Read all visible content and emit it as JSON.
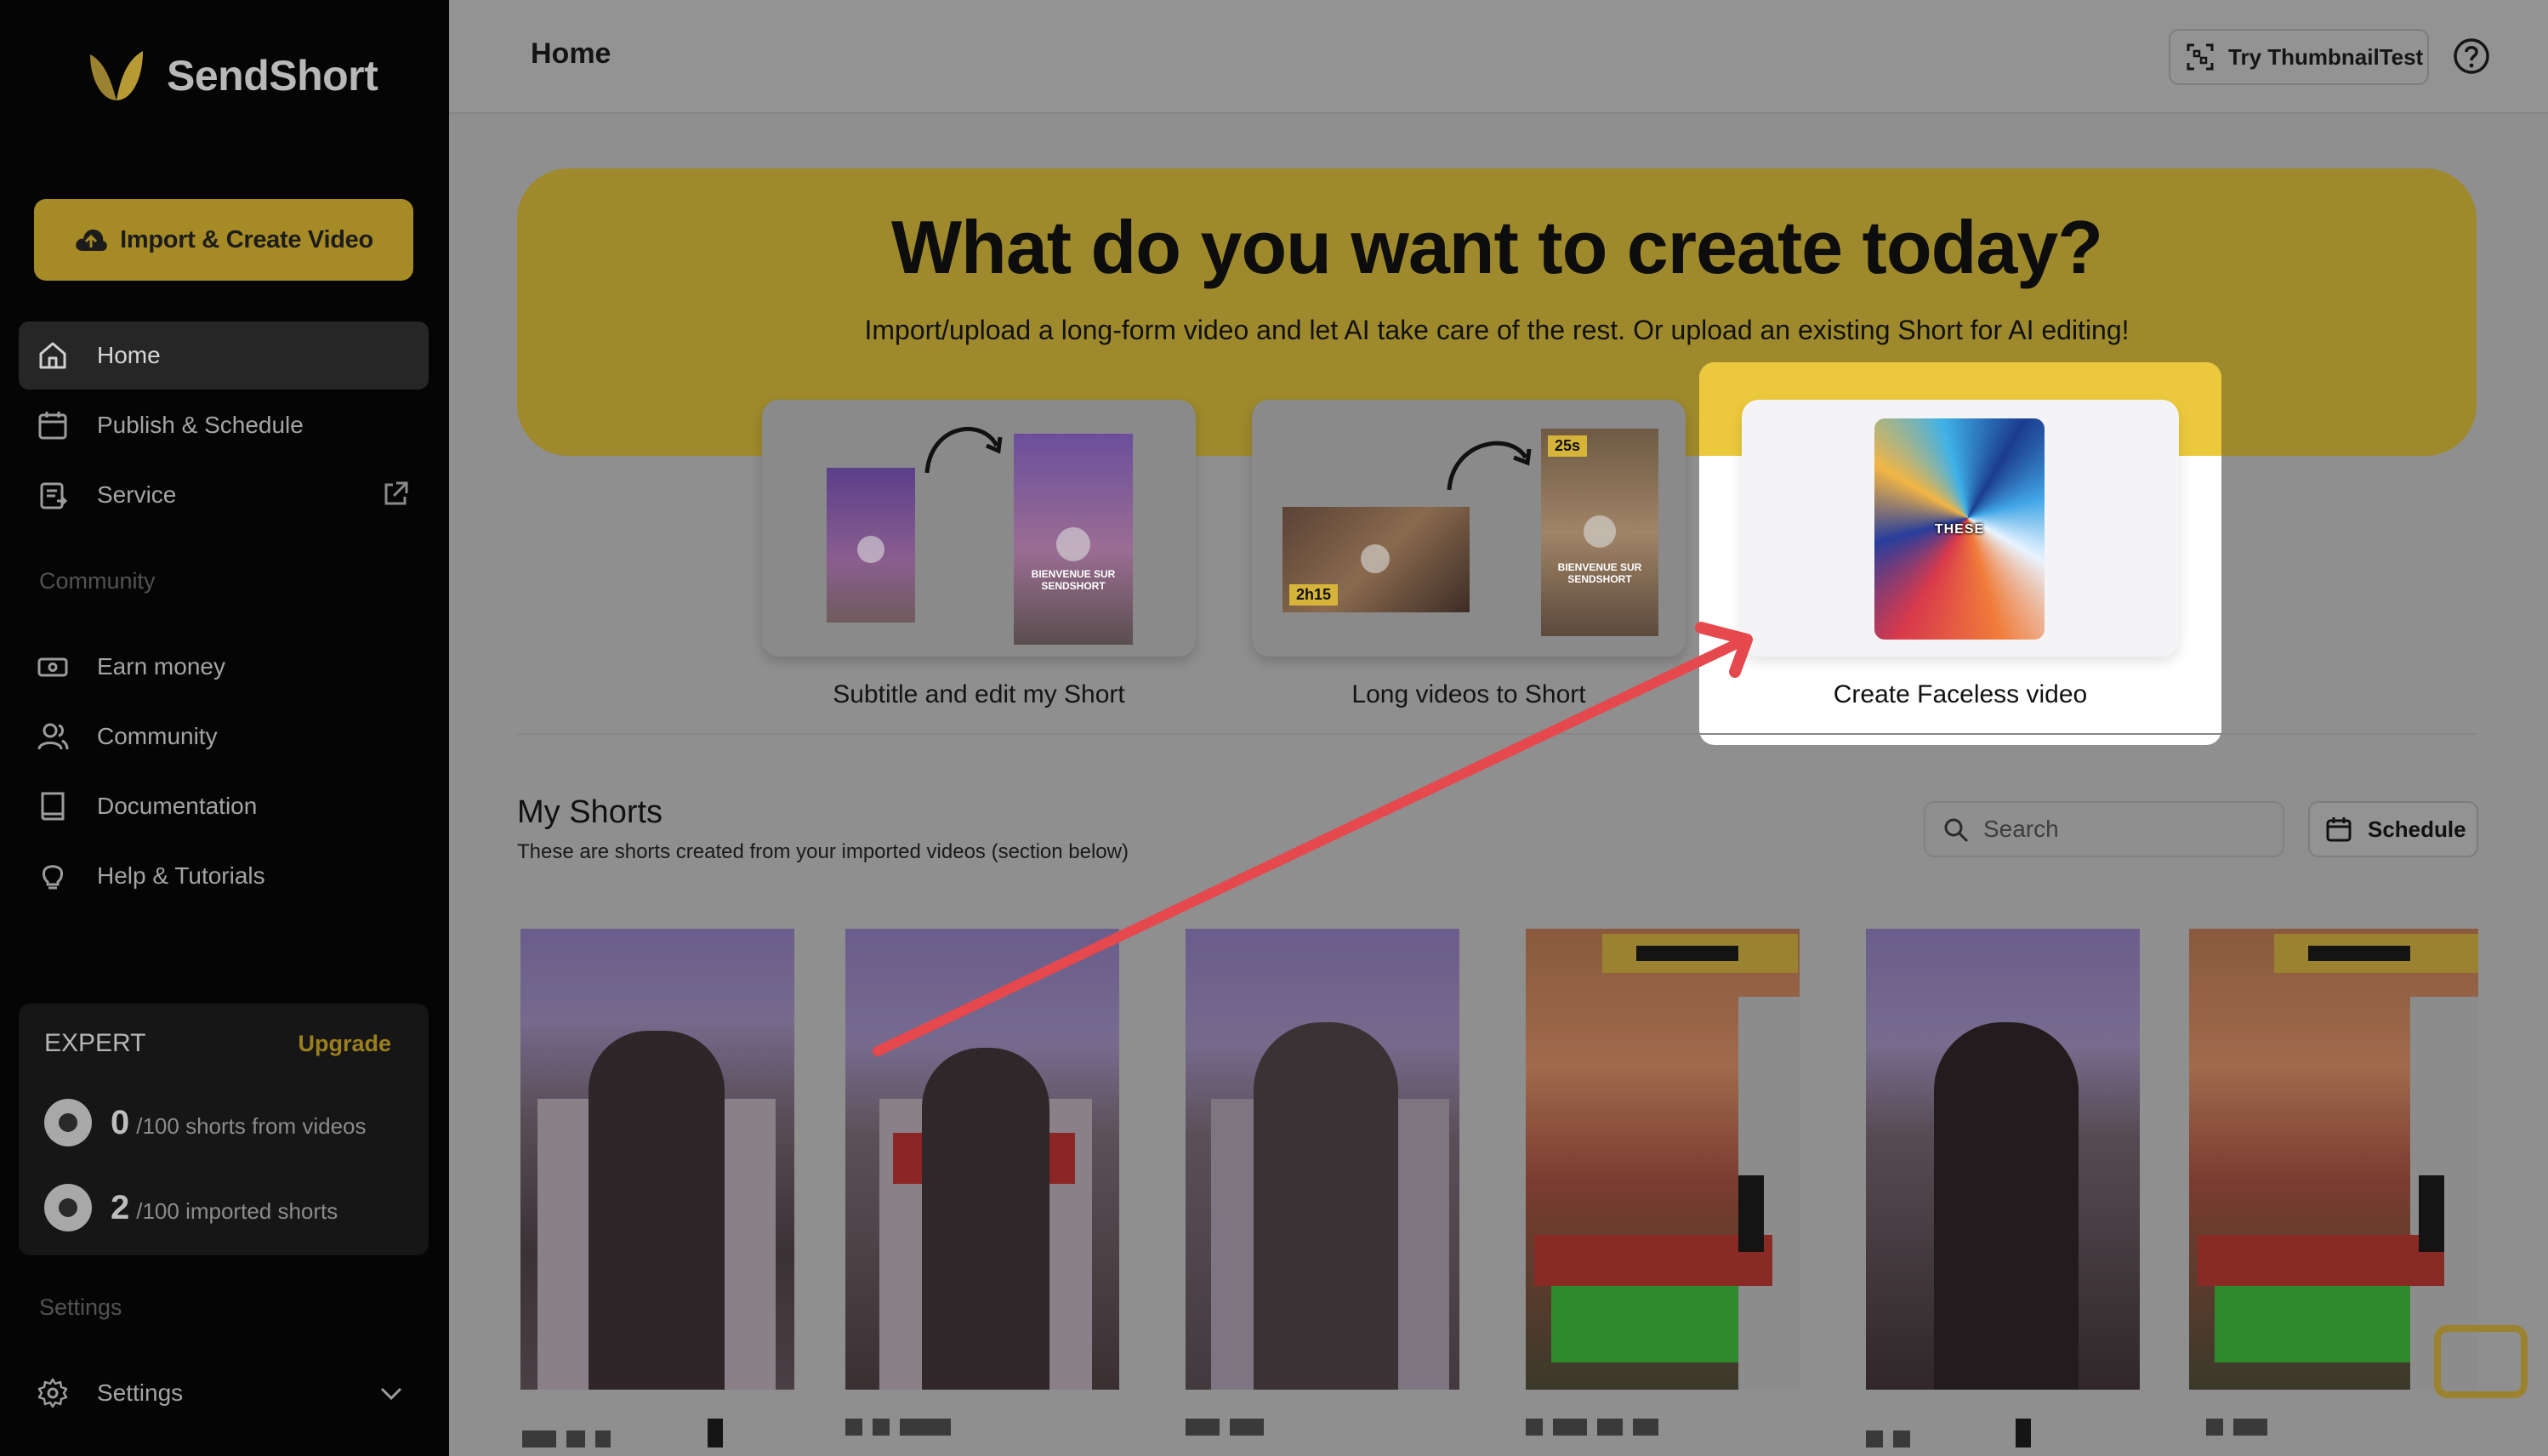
{
  "app": {
    "name": "SendShort"
  },
  "sidebar": {
    "import_button": "Import & Create Video",
    "nav": [
      {
        "label": "Home",
        "icon": "home-icon",
        "active": true
      },
      {
        "label": "Publish & Schedule",
        "icon": "calendar-icon"
      },
      {
        "label": "Service",
        "icon": "clipboard-icon",
        "external": true
      }
    ],
    "community_section": "Community",
    "community_nav": [
      {
        "label": "Earn money",
        "icon": "money-icon"
      },
      {
        "label": "Community",
        "icon": "users-icon"
      },
      {
        "label": "Documentation",
        "icon": "book-icon"
      },
      {
        "label": "Help & Tutorials",
        "icon": "lightbulb-icon"
      }
    ],
    "plan": {
      "name": "EXPERT",
      "upgrade": "Upgrade",
      "usage": [
        {
          "count": "0",
          "label": "/100 shorts from videos"
        },
        {
          "count": "2",
          "label": "/100 imported shorts"
        }
      ]
    },
    "settings_section": "Settings",
    "settings_item": "Settings"
  },
  "topbar": {
    "title": "Home",
    "thumbnail_button": "Try ThumbnailTest"
  },
  "hero": {
    "title": "What do you want to create today?",
    "subtitle": "Import/upload a long-form video and let AI take care of the rest. Or upload an existing Short for AI editing!",
    "options": [
      {
        "label": "Subtitle and edit my Short",
        "overlay": "BIENVENUE SUR SENDSHORT"
      },
      {
        "label": "Long videos to Short",
        "duration_badge": "2h15",
        "short_badge": "25s",
        "overlay": "BIENVENUE SUR SENDSHORT"
      },
      {
        "label": "Create Faceless video",
        "overlay": "THESE",
        "highlighted": true
      }
    ]
  },
  "shorts": {
    "title": "My Shorts",
    "subtitle": "These are shorts created from your imported videos (section below)",
    "search_placeholder": "Search",
    "schedule_button": "Schedule"
  },
  "colors": {
    "accent": "#ecc93c",
    "annotation_arrow": "#e5484d"
  }
}
